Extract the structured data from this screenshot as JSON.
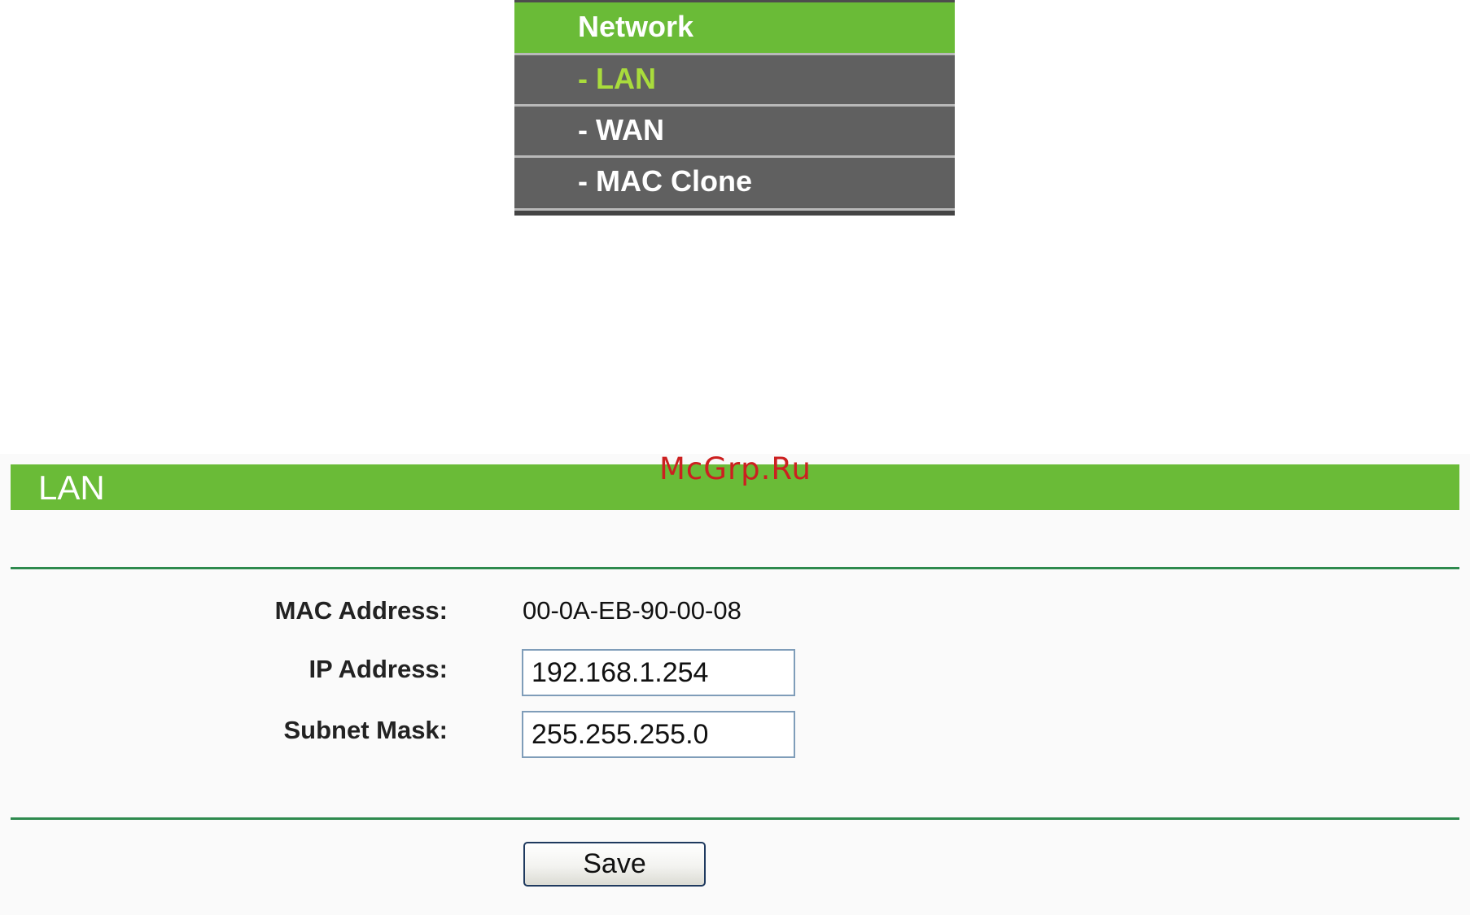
{
  "menu": {
    "header": "Network",
    "items": [
      {
        "label": "- LAN",
        "active": true
      },
      {
        "label": "- WAN",
        "active": false
      },
      {
        "label": "- MAC Clone",
        "active": false
      }
    ]
  },
  "panel": {
    "title": "LAN",
    "watermark": "McGrp.Ru",
    "fields": {
      "mac": {
        "label": "MAC Address:",
        "value": "00-0A-EB-90-00-08"
      },
      "ip": {
        "label": "IP Address:",
        "value": "192.168.1.254"
      },
      "subnet": {
        "label": "Subnet Mask:",
        "value": "255.255.255.0"
      }
    },
    "save_label": "Save"
  },
  "colors": {
    "accent_green": "#6abb37",
    "menu_gray": "#606060",
    "active_item_text": "#a9dc3c",
    "divider_green": "#2e8a4e",
    "watermark_red": "#cc2020"
  }
}
